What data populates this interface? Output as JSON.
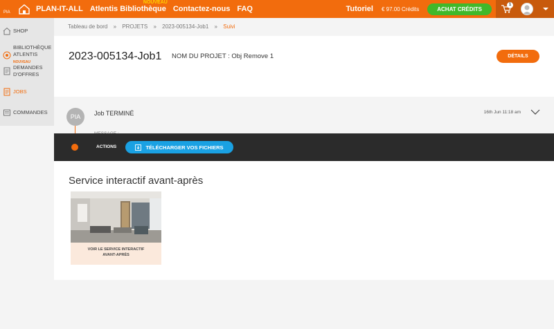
{
  "topbar": {
    "brand": "PLAN-IT-ALL",
    "nav": [
      {
        "label": "Atlentis Bibliothèque",
        "badge": "NOUVEAU"
      },
      {
        "label": "Contactez-nous"
      },
      {
        "label": "FAQ"
      }
    ],
    "tutoriel": "Tutoriel",
    "credits": "€ 97.00 Crédits",
    "buy_label": "ACHAT CRÉDITS",
    "cart_count": "1"
  },
  "sidebar": {
    "items": [
      {
        "label": "SHOP",
        "icon": "shop-icon"
      },
      {
        "label": "BIBLIOTHÈQUE",
        "label2": "ATLENTIS",
        "badge": "NOUVEAU",
        "icon": "library-icon"
      },
      {
        "label": "DEMANDES",
        "label2": "D'OFFRES",
        "icon": "quote-icon"
      },
      {
        "label": "JOBS",
        "icon": "jobs-icon",
        "active": true
      },
      {
        "label": "COMMANDES",
        "icon": "orders-icon"
      }
    ]
  },
  "breadcrumb": [
    "Tableau de bord",
    "PROJETS",
    "2023-005134-Job1",
    "Suivi"
  ],
  "breadcrumb_sep": "»",
  "job": {
    "title": "2023-005134-Job1",
    "project_name": "NOM DU PROJET : Obj Remove 1",
    "details_label": "DÉTAILS",
    "avatar_initials": "PIA",
    "status": "Job TERMINÉ",
    "date": "16th Jun 11:18 am",
    "message": "MESSAGE :-"
  },
  "actions": {
    "label": "ACTIONS",
    "download_label": "TÉLÉCHARGER VOS FICHIERS"
  },
  "service": {
    "title": "Service interactif avant-après",
    "caption_line1": "VOIR LE SERVICE INTERACTIF",
    "caption_line2": "AVANT-APRÈS"
  },
  "colors": {
    "brand_orange": "#f26c0d",
    "green": "#41b82a",
    "blue": "#1aa1e3",
    "dark": "#2b2b2b"
  }
}
